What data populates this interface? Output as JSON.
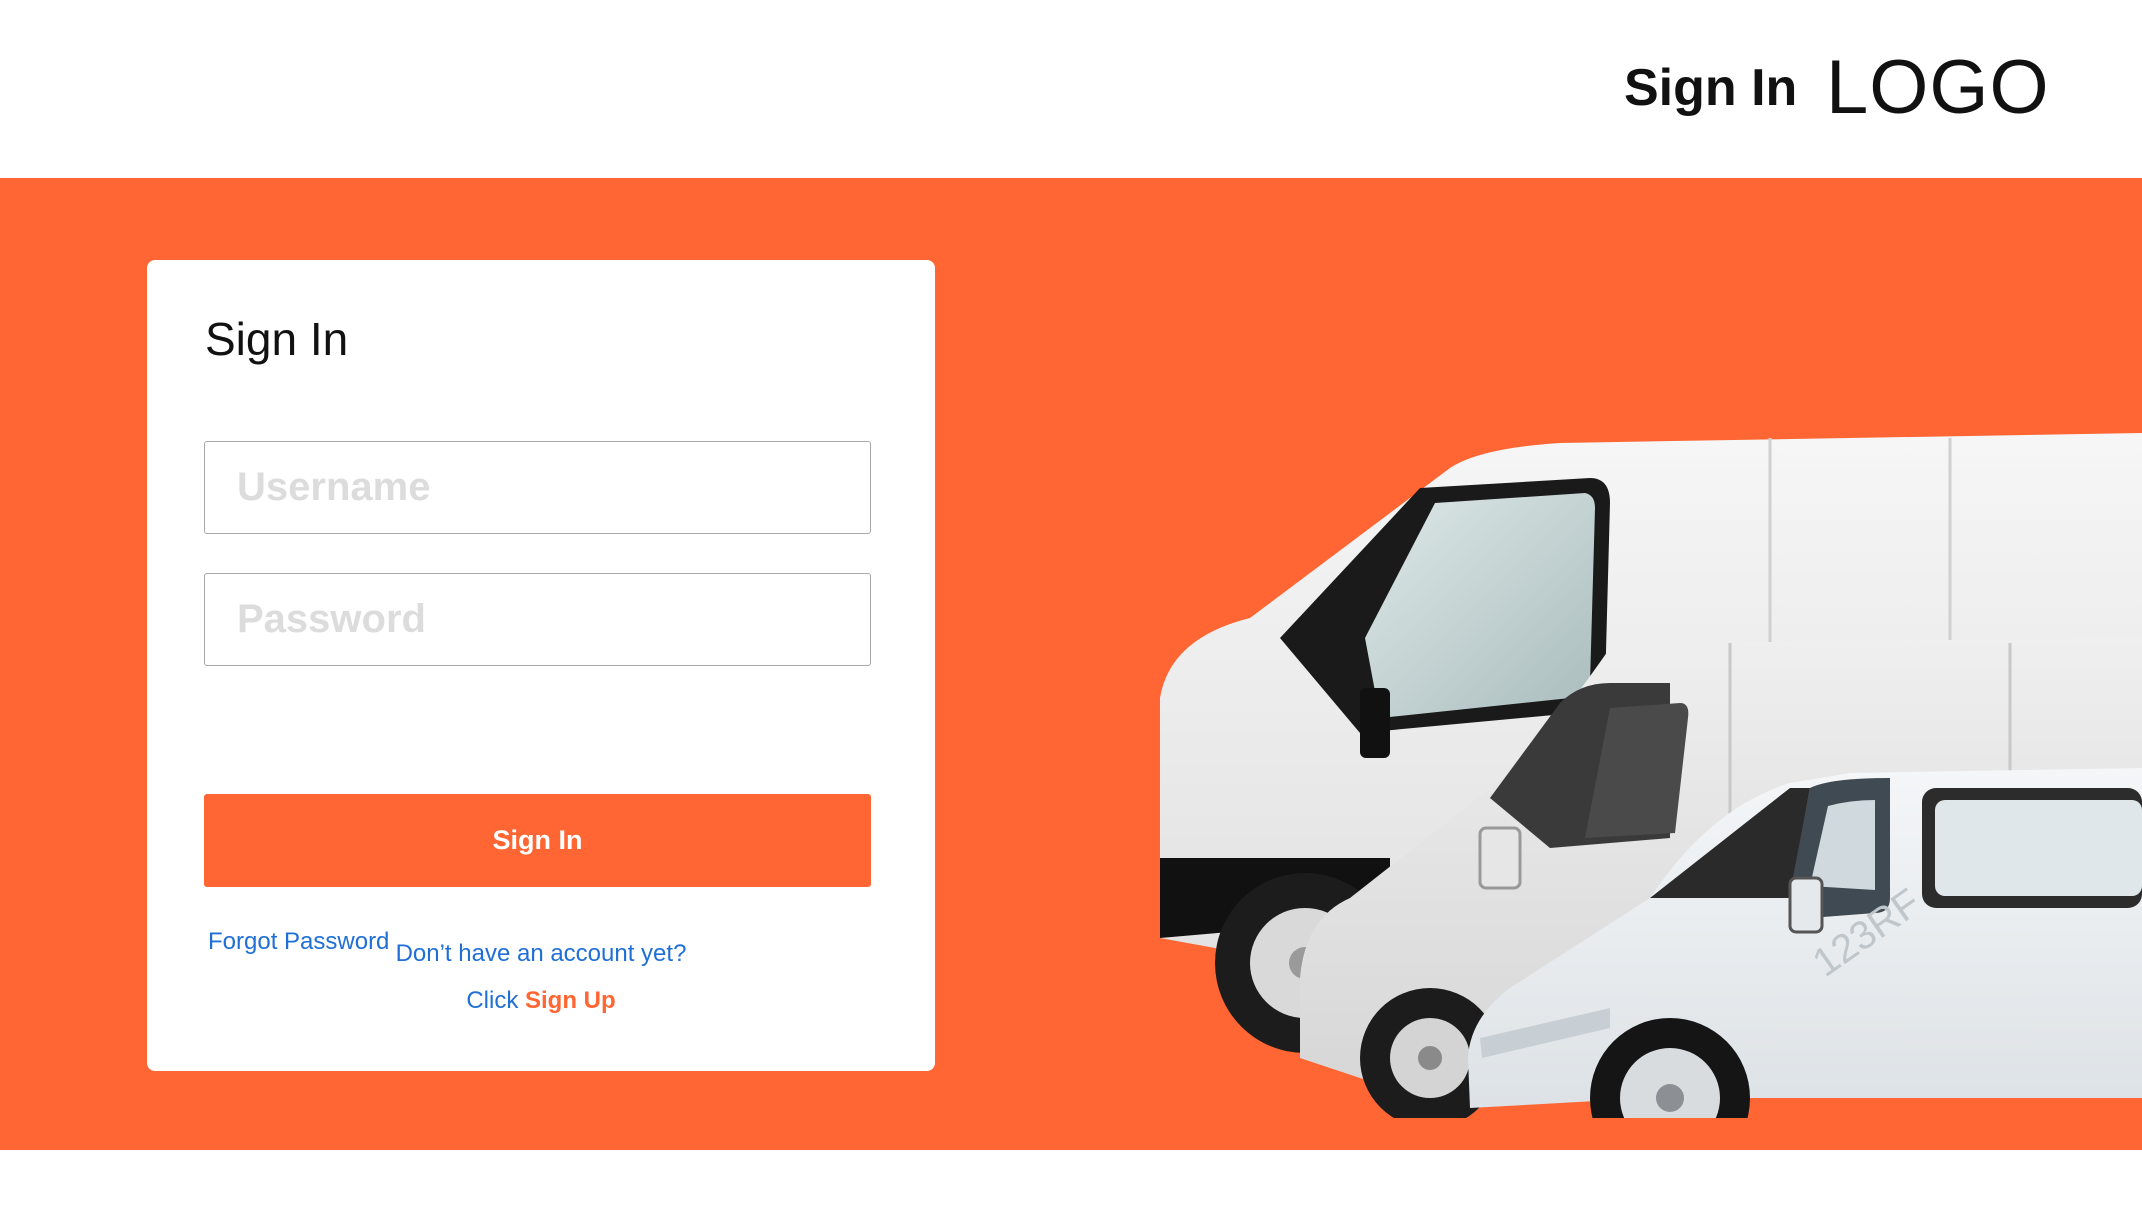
{
  "header": {
    "signin_link": "Sign In",
    "logo": "LOGO"
  },
  "card": {
    "title": "Sign In",
    "username_placeholder": "Username",
    "password_placeholder": "Password",
    "signin_button": "Sign In",
    "forgot_password": "Forgot Password",
    "no_account": "Don’t have an account yet?",
    "click_prefix": "Click",
    "signup_link": "Sign Up"
  },
  "hero": {
    "image": "vans-illustration",
    "watermark": "123RF"
  },
  "colors": {
    "accent": "#ff6633",
    "link": "#1f6fd6",
    "background": "#ffffff"
  }
}
